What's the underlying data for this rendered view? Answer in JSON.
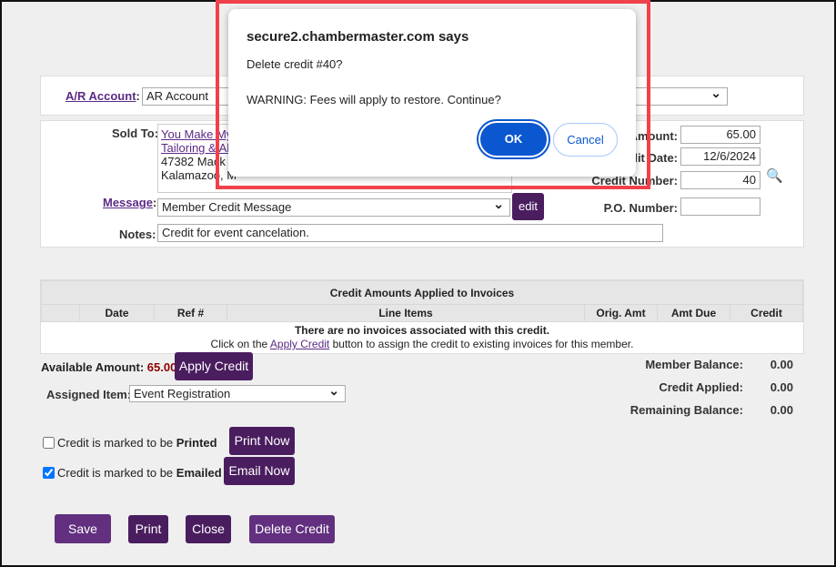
{
  "form": {
    "ar_account_label": "A/R Account",
    "ar_account_value": "AR Account",
    "sold_to_label": "Sold To:",
    "sold_to_line1": "You Make My",
    "sold_to_line2": "Tailoring & Al",
    "sold_to_line3": "47382 Mack",
    "sold_to_line4": "Kalamazoo, M",
    "message_label": "Message",
    "message_value": "Member Credit Message",
    "edit_label": "edit",
    "notes_label": "Notes:",
    "notes_value": "Credit for event cancelation.",
    "amount_label": "Amount:",
    "amount_value": "65.00",
    "date_label": "lit Date:",
    "date_value": "12/6/2024",
    "credit_number_label": "Credit Number:",
    "credit_number_value": "40",
    "po_label": "P.O. Number:",
    "po_value": ""
  },
  "table": {
    "title": "Credit Amounts Applied to Invoices",
    "columns": [
      "",
      "Date",
      "Ref #",
      "Line Items",
      "Orig. Amt",
      "Amt Due",
      "Credit"
    ],
    "empty_msg": "There are no invoices associated with this credit.",
    "hint_pre": "Click on the ",
    "hint_link": "Apply Credit",
    "hint_post": " button to assign the credit to existing invoices for this member."
  },
  "summary": {
    "available_label": "Available Amount:",
    "available_value": "65.00",
    "apply_credit": "Apply Credit",
    "assigned_label": "Assigned Item:",
    "assigned_value": "Event Registration",
    "member_balance_label": "Member Balance:",
    "member_balance": "0.00",
    "credit_applied_label": "Credit Applied:",
    "credit_applied": "0.00",
    "remaining_label": "Remaining Balance:",
    "remaining": "0.00"
  },
  "delivery": {
    "printed_pre": "Credit is marked to be ",
    "printed_bold": "Printed",
    "printed_checked": false,
    "print_now": "Print Now",
    "emailed_pre": "Credit is marked to be ",
    "emailed_bold": "Emailed",
    "emailed_checked": true,
    "email_now": "Email Now"
  },
  "actions": {
    "save": "Save",
    "print": "Print",
    "close": "Close",
    "delete": "Delete Credit"
  },
  "dialog": {
    "title": "secure2.chambermaster.com says",
    "line1": "Delete credit #40?",
    "line2": "WARNING: Fees will apply to restore. Continue?",
    "ok": "OK",
    "cancel": "Cancel"
  },
  "colors": {
    "accent": "#4a1d5f",
    "highlight": "#f0414a",
    "dialog_primary": "#0b57d0"
  }
}
